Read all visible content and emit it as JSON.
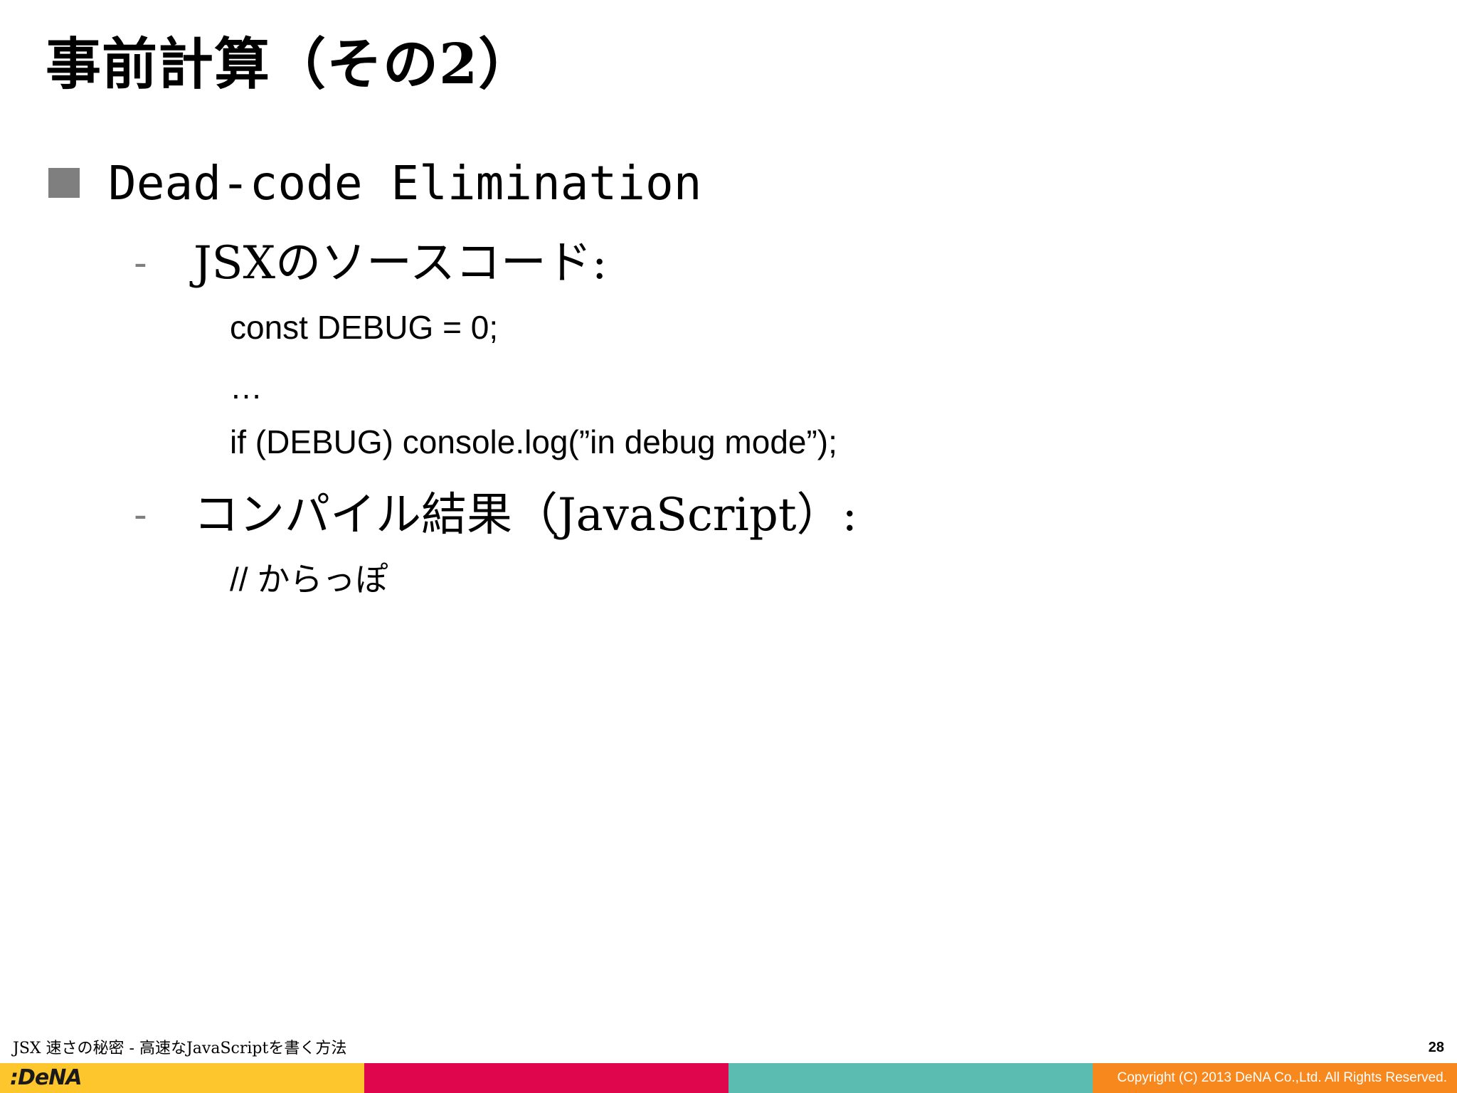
{
  "slide": {
    "title": "事前計算（その2）",
    "bullet1": "Dead-code Elimination",
    "sub1": "JSXのソースコード:",
    "code": [
      "const DEBUG = 0;",
      "…",
      "if (DEBUG) console.log(”in debug mode”);"
    ],
    "sub2": "コンパイル結果（JavaScript）:",
    "result": "// からっぽ",
    "dash": "-"
  },
  "footer": {
    "presentation_title": "JSX 速さの秘密 - 高速なJavaScriptを書く方法",
    "page_number": "28",
    "logo": ":DeNA",
    "copyright": "Copyright (C) 2013 DeNA Co.,Ltd. All Rights Reserved."
  },
  "colors": {
    "bullet_square": "#7f7f7f",
    "bar_yellow": "#fcc62c",
    "bar_magenta": "#e0064e",
    "bar_teal": "#5bbdb2",
    "bar_orange": "#f7881e"
  },
  "icons": {
    "bullet_marker": "square-bullet-icon",
    "logo": "dena-logo"
  }
}
